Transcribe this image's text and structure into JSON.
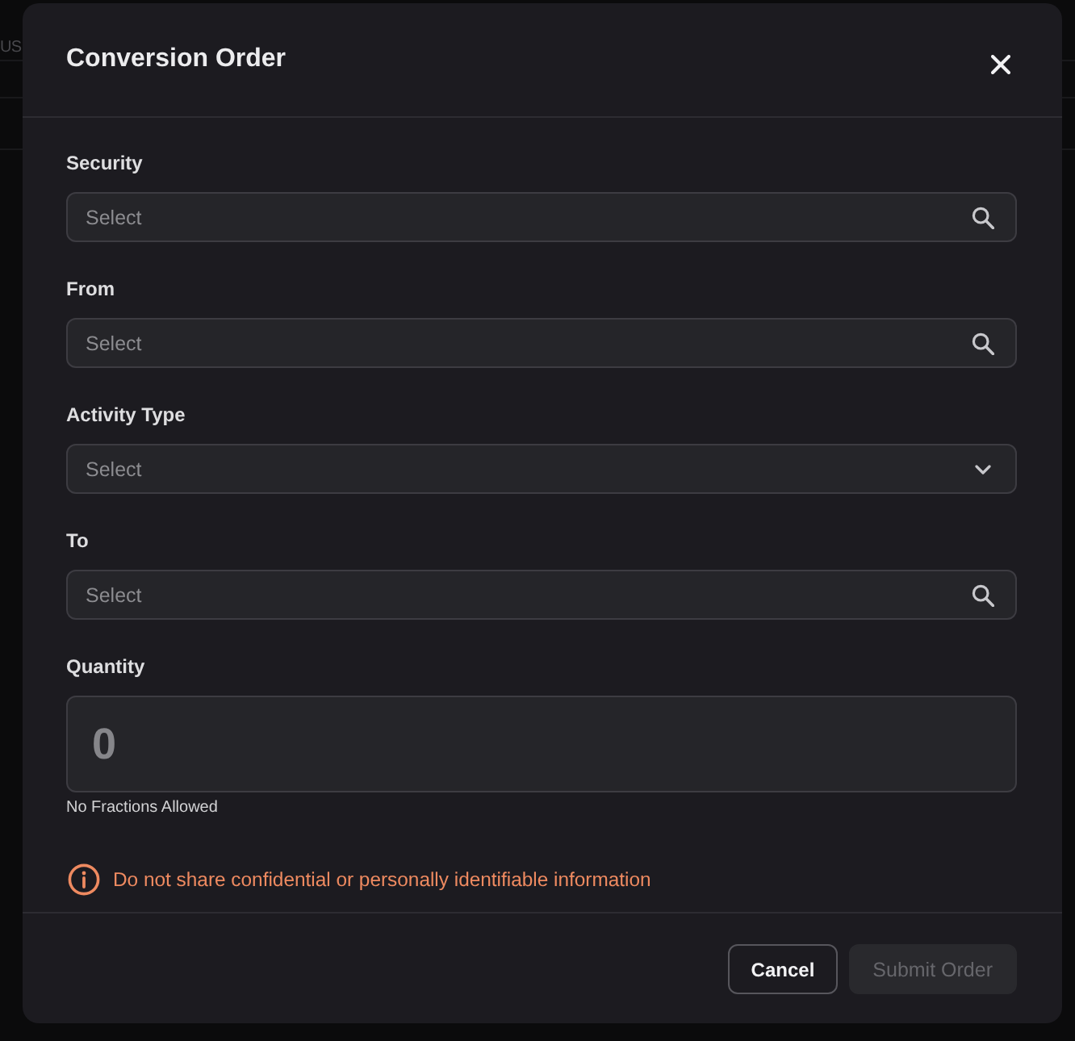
{
  "background_page": {
    "text": "US"
  },
  "dialog": {
    "title": "Conversion Order",
    "fields": [
      {
        "label": "Security",
        "kind": "search",
        "placeholder": "Select"
      },
      {
        "label": "From",
        "kind": "search",
        "placeholder": "Select"
      },
      {
        "label": "Activity Type",
        "kind": "dropdown",
        "placeholder": "Select"
      },
      {
        "label": "To",
        "kind": "search",
        "placeholder": "Select"
      },
      {
        "label": "Quantity",
        "kind": "number",
        "placeholder": "0",
        "hint": "No Fractions Allowed"
      }
    ],
    "notice": "Do not share confidential or personally identifiable information",
    "buttons": [
      {
        "label": "Cancel",
        "kind": "secondary",
        "disabled": false
      },
      {
        "label": "Submit Order",
        "kind": "primary",
        "disabled": true
      }
    ]
  }
}
